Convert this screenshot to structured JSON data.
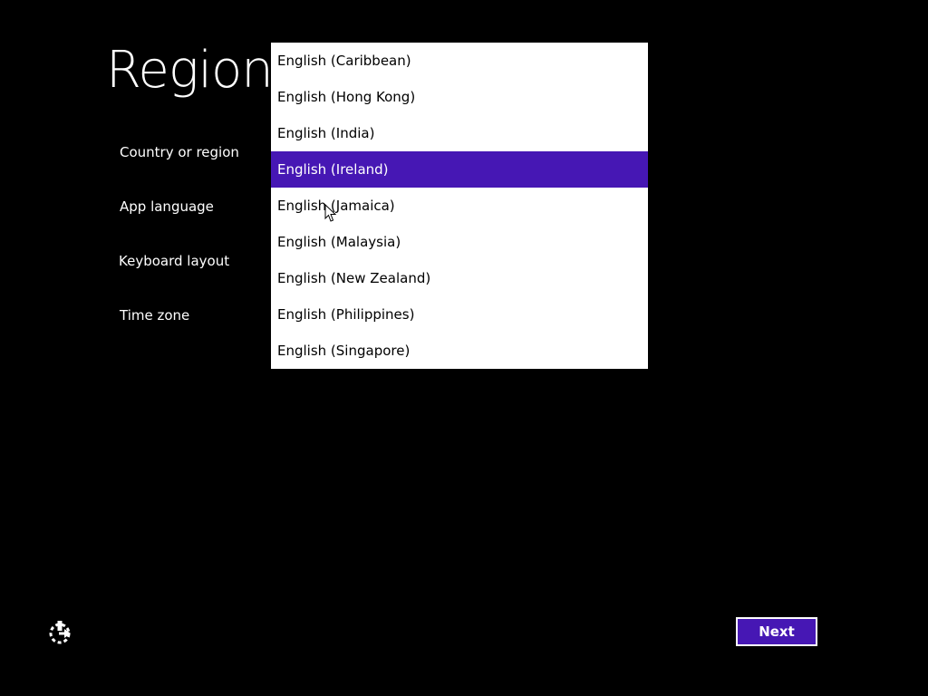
{
  "page": {
    "title": "Region"
  },
  "fields": {
    "country": "Country or region",
    "app_language": "App language",
    "keyboard_layout": "Keyboard layout",
    "time_zone": "Time zone"
  },
  "dropdown": {
    "selected_value": "English (Ireland)",
    "options": [
      {
        "label": "English (Caribbean)"
      },
      {
        "label": "English (Hong Kong)"
      },
      {
        "label": "English (India)"
      },
      {
        "label": "English (Ireland)"
      },
      {
        "label": "English (Jamaica)"
      },
      {
        "label": "English (Malaysia)"
      },
      {
        "label": "English (New Zealand)"
      },
      {
        "label": "English (Philippines)"
      },
      {
        "label": "English (Singapore)"
      }
    ]
  },
  "buttons": {
    "next": "Next"
  },
  "icons": {
    "ease_of_access": "ease-of-access-icon",
    "cursor": "mouse-cursor-icon"
  },
  "colors": {
    "background": "#000000",
    "accent": "#4617b4",
    "list_background": "#ffffff"
  }
}
